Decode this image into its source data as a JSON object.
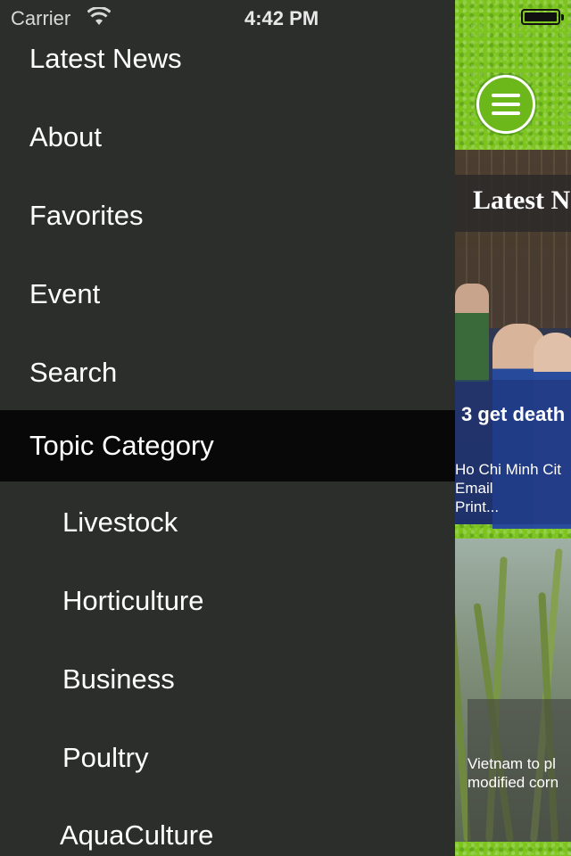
{
  "status_bar": {
    "carrier": "Carrier",
    "time": "4:42 PM"
  },
  "drawer": {
    "menu_items": [
      {
        "label": "Latest News"
      },
      {
        "label": "About"
      },
      {
        "label": "Favorites"
      },
      {
        "label": "Event"
      },
      {
        "label": "Search"
      },
      {
        "label": "Topic Category",
        "selected": true
      }
    ],
    "sub_items": [
      {
        "label": "Livestock"
      },
      {
        "label": "Horticulture"
      },
      {
        "label": "Business"
      },
      {
        "label": "Poultry"
      },
      {
        "label": "AquaCulture"
      }
    ]
  },
  "content": {
    "section_title": "Latest N",
    "article1": {
      "headline": "3 get death",
      "snippet_lines": [
        "Ho Chi Minh Cit",
        "Email",
        "Print..."
      ]
    },
    "article2": {
      "caption_lines": [
        "Vietnam to pl",
        "modified corn"
      ]
    }
  },
  "icons": {
    "menu_button": "hamburger-menu-icon",
    "wifi": "wifi-icon",
    "battery": "battery-icon"
  },
  "colors": {
    "drawer_bg": "#2c2e2c",
    "selected_bg": "#080808",
    "accent_green": "#7cc41e"
  }
}
